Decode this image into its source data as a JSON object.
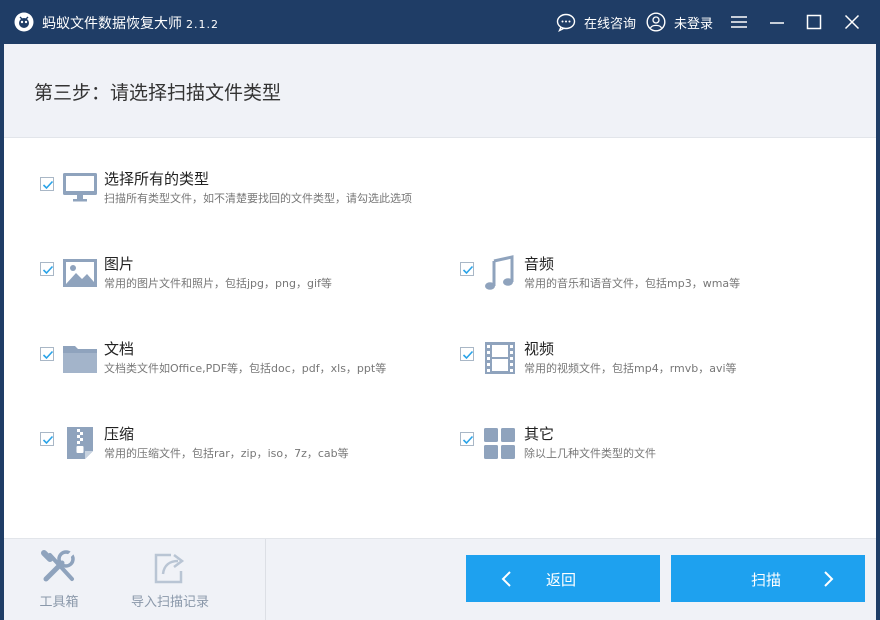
{
  "window": {
    "title": "蚂蚁文件数据恢复大师",
    "version": "2.1.2",
    "consult_label": "在线咨询",
    "login_label": "未登录"
  },
  "step": {
    "title": "第三步：请选择扫描文件类型"
  },
  "options": {
    "all": {
      "title": "选择所有的类型",
      "desc": "扫描所有类型文件，如不清楚要找回的文件类型，请勾选此选项",
      "checked": true,
      "icon": "monitor-icon"
    },
    "image": {
      "title": "图片",
      "desc": "常用的图片文件和照片，包括jpg，png，gif等",
      "checked": true,
      "icon": "image-icon"
    },
    "audio": {
      "title": "音频",
      "desc": "常用的音乐和语音文件，包括mp3，wma等",
      "checked": true,
      "icon": "music-note-icon"
    },
    "document": {
      "title": "文档",
      "desc": "文档类文件如Office,PDF等，包括doc，pdf，xls，ppt等",
      "checked": true,
      "icon": "folder-icon"
    },
    "video": {
      "title": "视频",
      "desc": "常用的视频文件，包括mp4，rmvb，avi等",
      "checked": true,
      "icon": "film-icon"
    },
    "archive": {
      "title": "压缩",
      "desc": "常用的压缩文件，包括rar，zip，iso，7z，cab等",
      "checked": true,
      "icon": "zip-file-icon"
    },
    "other": {
      "title": "其它",
      "desc": "除以上几种文件类型的文件",
      "checked": true,
      "icon": "grid-icon"
    }
  },
  "bottom": {
    "toolbox_label": "工具箱",
    "import_label": "导入扫描记录",
    "back_label": "返回",
    "scan_label": "扫描"
  },
  "colors": {
    "titlebar": "#1f3d66",
    "accent": "#1ea1ef",
    "icon": "#8fa3bd",
    "panel": "#f0f2f7"
  }
}
